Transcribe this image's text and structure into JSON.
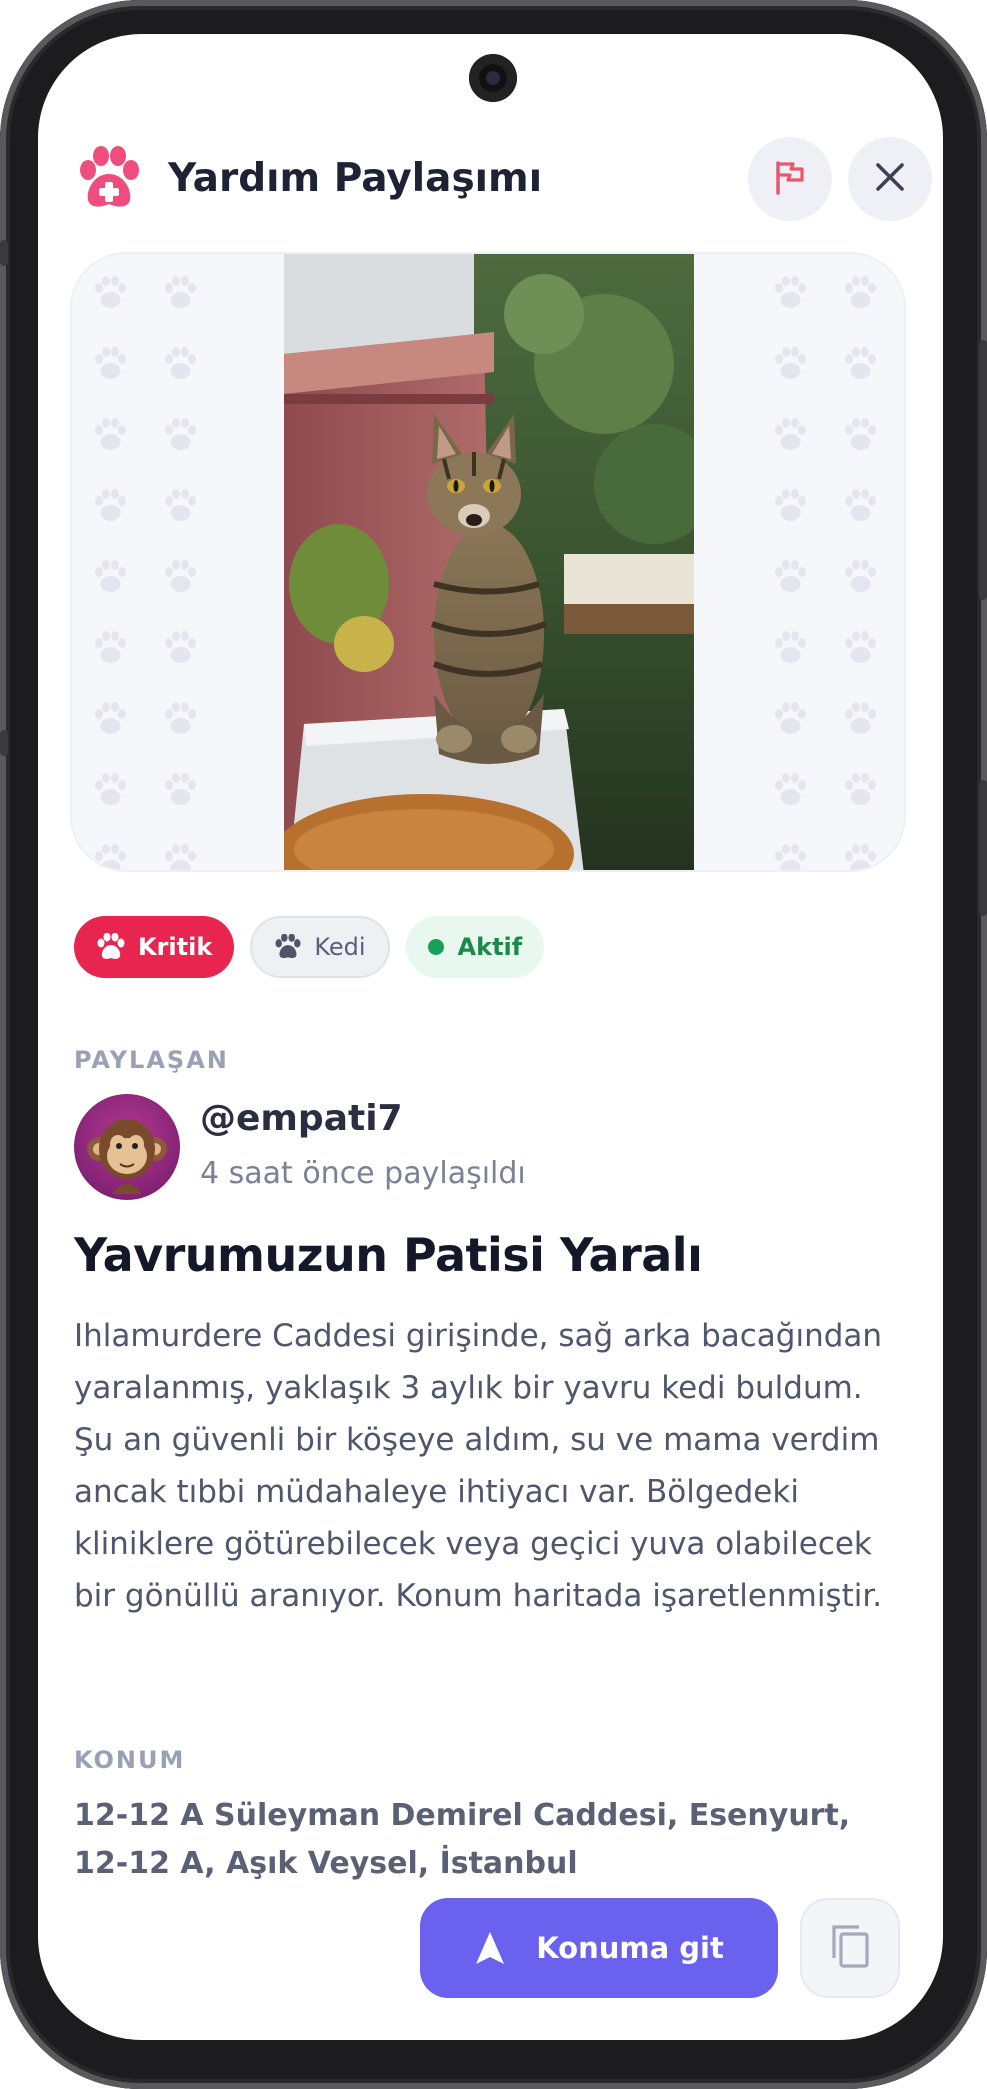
{
  "header": {
    "title": "Yardım Paylaşımı",
    "logo_icon": "paw-medical-icon",
    "report_icon": "flag-icon",
    "close_icon": "close-icon"
  },
  "post": {
    "image_alt": "tabby cat sitting on a white ledge",
    "tags": [
      {
        "label": "Kritik",
        "icon": "paw-icon",
        "color": "#e8254f"
      },
      {
        "label": "Kedi",
        "icon": "paw-icon"
      },
      {
        "label": "Aktif",
        "icon": "status-dot-icon",
        "color": "#17a05a"
      }
    ],
    "author_label": "PAYLAŞAN",
    "author": {
      "username": "@empati7",
      "time": "4 saat önce paylaşıldı",
      "avatar_icon": "monkey-avatar-icon"
    },
    "title": "Yavrumuzun Patisi Yaralı",
    "body": "Ihlamurdere Caddesi girişinde, sağ arka bacağından yaralanmış, yaklaşık 3 aylık bir yavru kedi buldum. Şu an güvenli bir köşeye aldım, su ve mama verdim ancak tıbbi müdahaleye ihtiyacı var. Bölgedeki kliniklere götürebilecek veya geçici yuva olabilecek bir gönüllü aranıyor. Konum haritada işaretlenmiştir.",
    "location_label": "KONUM",
    "address": "12-12 A Süleyman Demirel Caddesi, Esenyurt, 12-12 A, Aşık Veysel, İstanbul"
  },
  "actions": {
    "go_label": "Konuma git",
    "go_icon": "navigation-arrow-icon",
    "copy_icon": "copy-icon"
  },
  "colors": {
    "accent": "#6a62ef",
    "critical": "#e8254f",
    "logo": "#ee4d7e"
  }
}
